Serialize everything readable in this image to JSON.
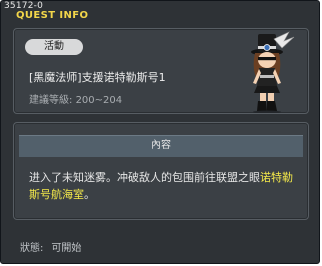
{
  "quest_id": "35172-0",
  "window_title": "QUEST INFO",
  "badge": "活動",
  "quest_name": "[黑魔法师]支援诺特勒斯号1",
  "level_label": "建議等級:",
  "level_range": "200~204",
  "content_header": "內容",
  "description_prefix": "进入了未知迷雾。冲破敌人的包围前往联盟之眼",
  "description_highlight": "诺特勒斯号航海室",
  "description_suffix": "。",
  "status_label": "狀態:",
  "status_value": "可開始",
  "colors": {
    "title": "#f3d64a",
    "highlight": "#f5ea4a",
    "panel": "#3b4045",
    "window": "#2e3236"
  }
}
